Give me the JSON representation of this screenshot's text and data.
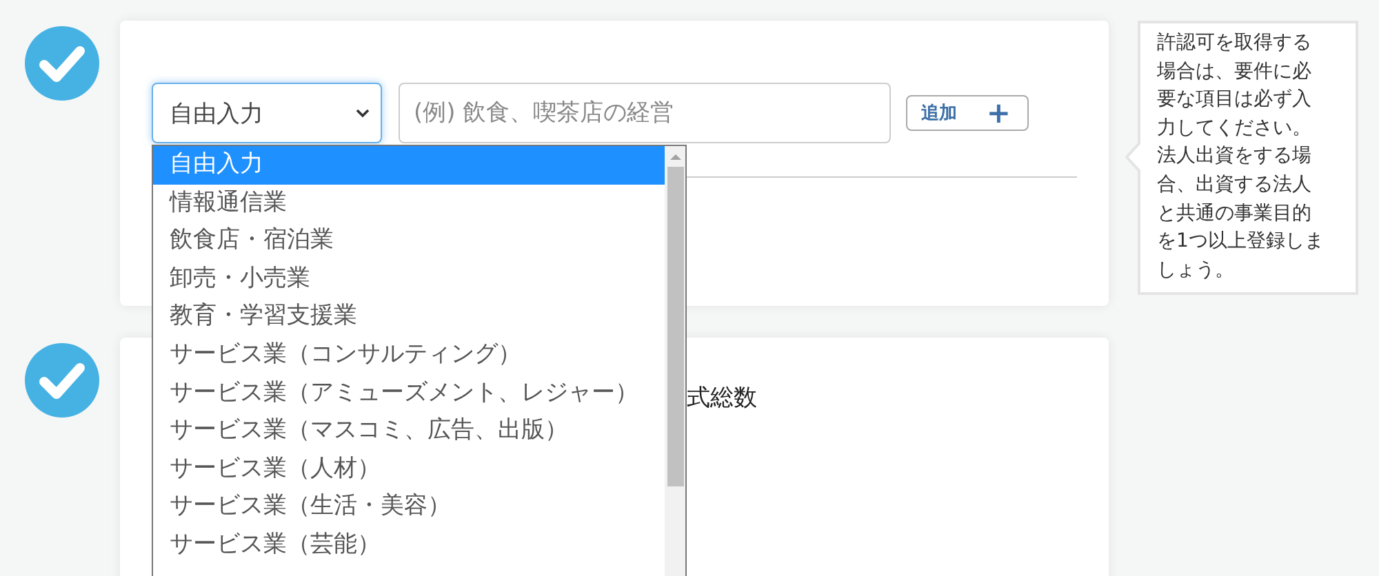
{
  "steps": [
    {
      "completed": true,
      "kind": "purpose"
    },
    {
      "completed": true,
      "kind": "shares"
    }
  ],
  "purpose_form": {
    "category_select": {
      "value": "自由入力",
      "expanded": true
    },
    "purpose_input": {
      "placeholder": "(例) 飲食、喫茶店の経営"
    },
    "add_button": {
      "label": "追加",
      "icon": "+"
    },
    "options": [
      {
        "label": "自由入力",
        "selected": true
      },
      {
        "label": "情報通信業",
        "selected": false
      },
      {
        "label": "飲食店・宿泊業",
        "selected": false
      },
      {
        "label": "卸売・小売業",
        "selected": false
      },
      {
        "label": "教育・学習支援業",
        "selected": false
      },
      {
        "label": "サービス業（コンサルティング）",
        "selected": false
      },
      {
        "label": "サービス業（アミューズメント、レジャー）",
        "selected": false
      },
      {
        "label": "サービス業（マスコミ、広告、出版）",
        "selected": false
      },
      {
        "label": "サービス業（人材）",
        "selected": false
      },
      {
        "label": "サービス業（生活・美容）",
        "selected": false
      },
      {
        "label": "サービス業（芸能）",
        "selected": false
      }
    ]
  },
  "help_tip": {
    "text": "許認可を取得する場合は、要件に必要な項目は必ず入力してください。法人出資をする場合、出資する法人と共通の事業目的を1つ以上登録しましょう。"
  },
  "shares_card": {
    "label": "式総数"
  }
}
